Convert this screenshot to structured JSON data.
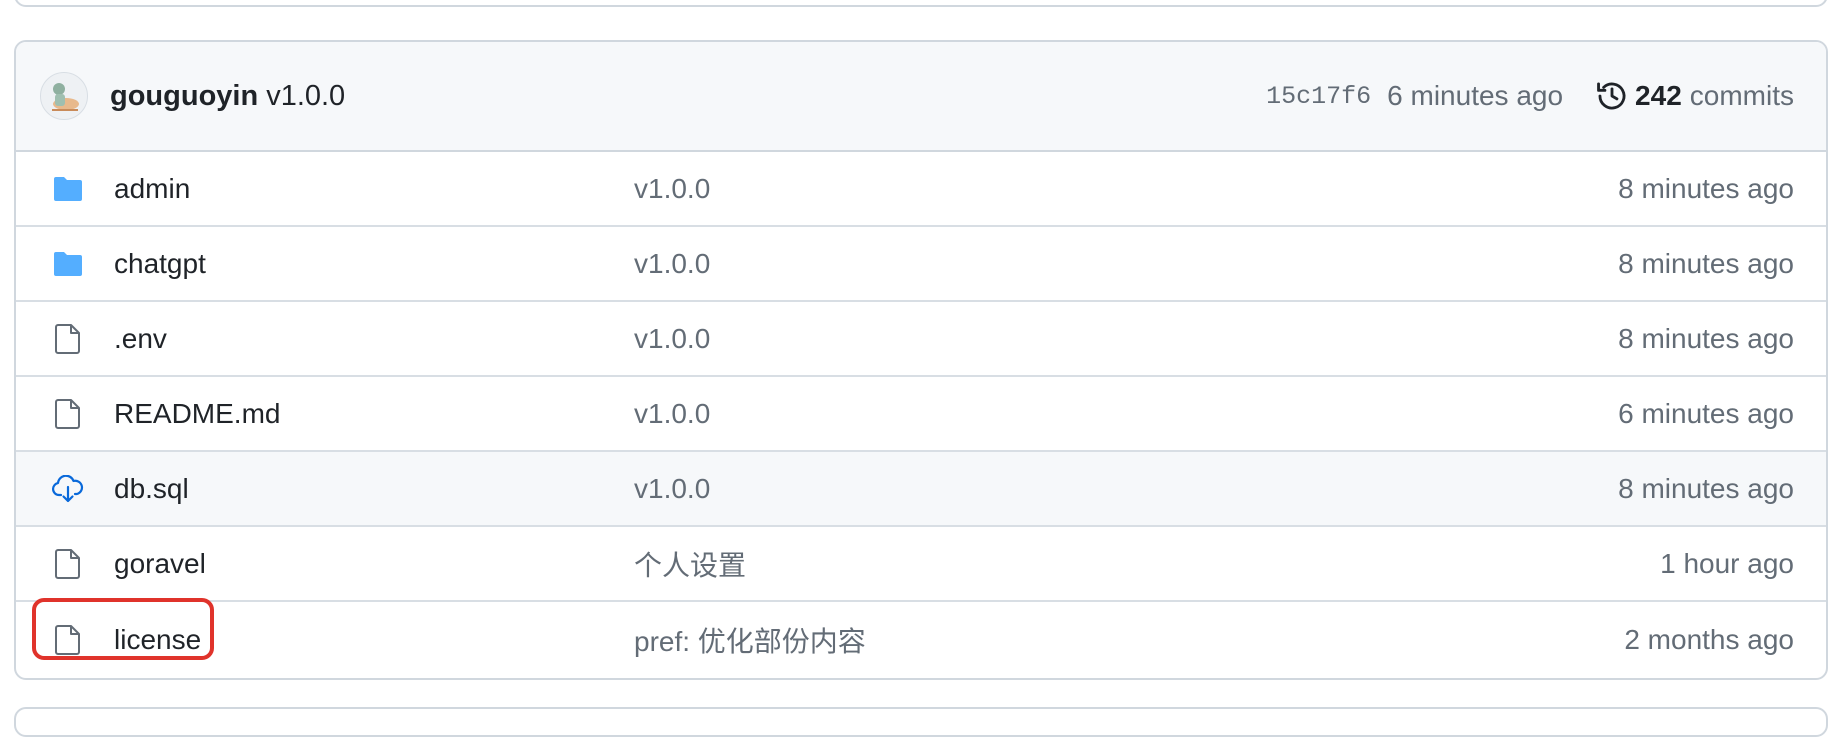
{
  "latest_commit": {
    "author": "gouguoyin",
    "message": "v1.0.0",
    "sha": "15c17f6",
    "time": "6 minutes ago",
    "commit_count": "242",
    "commits_label": "commits"
  },
  "files": [
    {
      "name": "admin",
      "icon": "folder-icon",
      "message": "v1.0.0",
      "age": "8 minutes ago"
    },
    {
      "name": "chatgpt",
      "icon": "folder-icon",
      "message": "v1.0.0",
      "age": "8 minutes ago"
    },
    {
      "name": ".env",
      "icon": "file-icon",
      "message": "v1.0.0",
      "age": "8 minutes ago"
    },
    {
      "name": "README.md",
      "icon": "file-icon",
      "message": "v1.0.0",
      "age": "6 minutes ago"
    },
    {
      "name": "db.sql",
      "icon": "cloud-download-icon",
      "message": "v1.0.0",
      "age": "8 minutes ago"
    },
    {
      "name": "goravel",
      "icon": "file-icon",
      "message": "个人设置",
      "age": "1 hour ago"
    },
    {
      "name": "license",
      "icon": "file-icon",
      "message": "pref: 优化部份内容",
      "age": "2 months ago"
    }
  ],
  "colors": {
    "folder": "#54aeff",
    "highlight": "#e0332b",
    "muted": "#636c76",
    "border": "#d0d7de"
  }
}
